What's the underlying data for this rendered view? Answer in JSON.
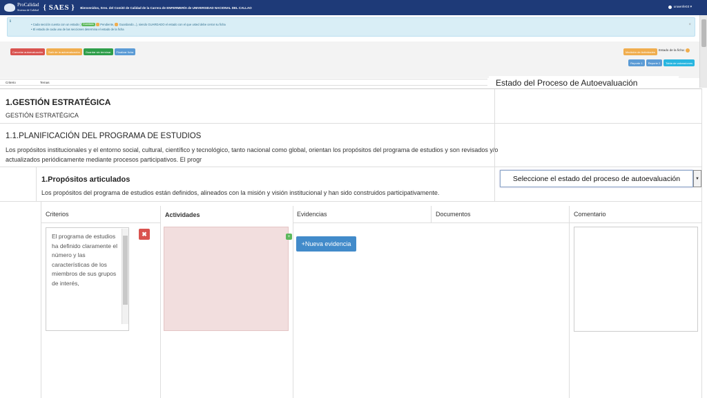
{
  "header": {
    "logo_line1": "ProCalidad",
    "logo_line2": "Sistema de Calidad",
    "logo_saes": "{ SAES }",
    "welcome": "Bienvenidos, Sres. del Comité de Calidad de la Carrera de ENFERMERÍA de UNIVERSIDAD NACIONAL DEL CALLAO",
    "user": "unaenfe03 ▾"
  },
  "alert": {
    "line1_a": "Cada sección cuenta con un estado (",
    "pill_guardado": "Guardado",
    "line1_b": "Pendiente,",
    "line1_c": "Guardando...), siendo GUARDADO el estado con el que usted debe cerrar su ficha",
    "line2": "El estado de cada una de las secciones determina el estado de la ficha",
    "colors": {
      "guardado": "#5cb85c",
      "pendiente": "#f0ad4e"
    }
  },
  "toolbar": {
    "buttons": [
      {
        "label": "Cancelar autoevaluación",
        "color": "#d9534f"
      },
      {
        "label": "Salir de la autoevaluación",
        "color": "#f0ad4e"
      },
      {
        "label": "Guardar sin terminar",
        "color": "#5cb85c"
      },
      {
        "label": "Finalizar ficha",
        "color": "#5b9bd5"
      }
    ],
    "medicion": "Medición de Actividades",
    "estado_ficha": "Estado de la ficha:",
    "reporte1": "Reporte 1",
    "reporte2": "Reporte 2",
    "tabla": "Tabla de valoraciones"
  },
  "mini_table": {
    "col1": "Criterio",
    "col2": "Temas"
  },
  "estado_panel_title": "Estado del Proceso de Autoevaluación",
  "section": {
    "title": "1.GESTIÓN ESTRATÉGICA",
    "subtitle": "GESTIÓN ESTRATÉGICA",
    "sub_title": "1.1.PLANIFICACIÓN DEL PROGRAMA DE ESTUDIOS",
    "sub_text_1": "Los propósitos institucionales y el entorno social, cultural, científico y tecnológico, tanto nacional como global, orientan los propósitos del programa de estudios y son revisados y/o",
    "sub_text_2": "actualizados periódicamente mediante procesos participativos. El progr",
    "item_title": "1.Propósitos articulados",
    "item_text": "Los propósitos del programa de estudios están definidos, alineados con la misión y visión institucional y han sido construidos participativamente.",
    "select_label": "Seleccione el estado del proceso de autoevaluación"
  },
  "grid": {
    "criterios": "Criterios",
    "actividades": "Actividades",
    "evidencias": "Evidencias",
    "documentos": "Documentos",
    "comentario": "Comentario",
    "criterio_text": "El programa de estudios ha definido claramente el número y las características de los miembros de sus grupos de interés,",
    "nueva_evidencia": "+Nueva evidencia"
  }
}
